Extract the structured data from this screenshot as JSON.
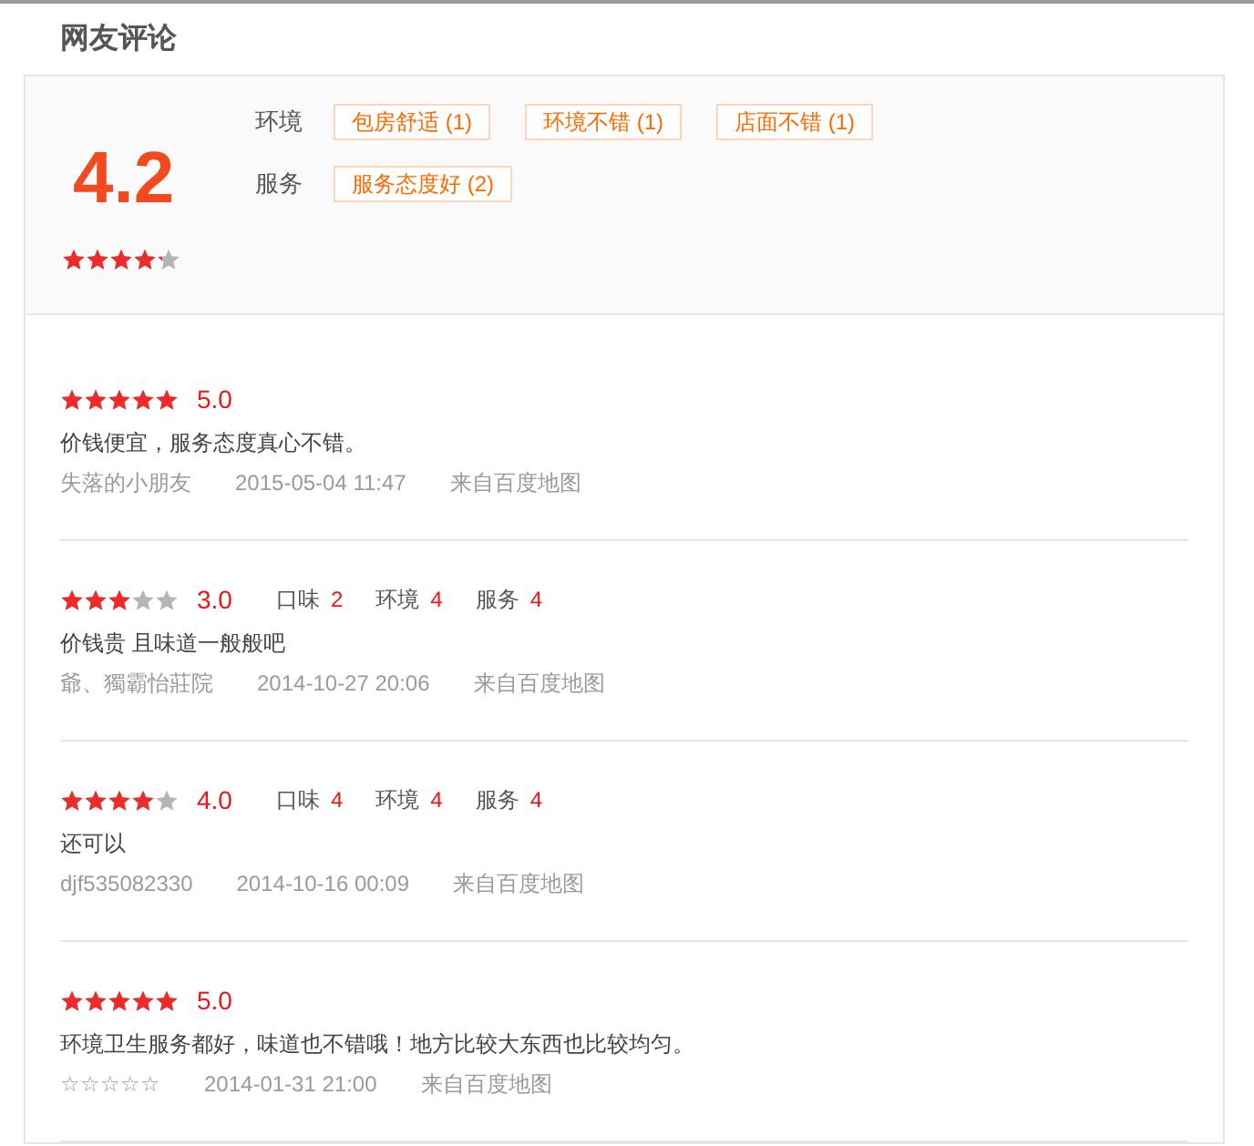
{
  "title": "网友评论",
  "summary": {
    "score": "4.2",
    "stars": 4.2,
    "tag_groups": [
      {
        "label": "环境",
        "tags": [
          "包房舒适 (1)",
          "环境不错 (1)",
          "店面不错 (1)"
        ]
      },
      {
        "label": "服务",
        "tags": [
          "服务态度好 (2)"
        ]
      }
    ]
  },
  "reviews": [
    {
      "stars": 5,
      "score": "5.0",
      "text": "价钱便宜，服务态度真心不错。",
      "user": "失落的小朋友",
      "time": "2015-05-04 11:47",
      "source": "来自百度地图"
    },
    {
      "stars": 3,
      "score": "3.0",
      "aspects": [
        {
          "label": "口味",
          "value": "2"
        },
        {
          "label": "环境",
          "value": "4"
        },
        {
          "label": "服务",
          "value": "4"
        }
      ],
      "text": "价钱贵 且味道一般般吧",
      "user": "爺、獨霸怡莊院",
      "time": "2014-10-27 20:06",
      "source": "来自百度地图"
    },
    {
      "stars": 4,
      "score": "4.0",
      "aspects": [
        {
          "label": "口味",
          "value": "4"
        },
        {
          "label": "环境",
          "value": "4"
        },
        {
          "label": "服务",
          "value": "4"
        }
      ],
      "text": "还可以",
      "user": "djf535082330",
      "time": "2014-10-16 00:09",
      "source": "来自百度地图"
    },
    {
      "stars": 5,
      "score": "5.0",
      "text": "环境卫生服务都好，味道也不错哦！地方比较大东西也比较均匀。",
      "user": "☆☆☆☆☆",
      "time": "2014-01-31 21:00",
      "source": "来自百度地图"
    }
  ]
}
